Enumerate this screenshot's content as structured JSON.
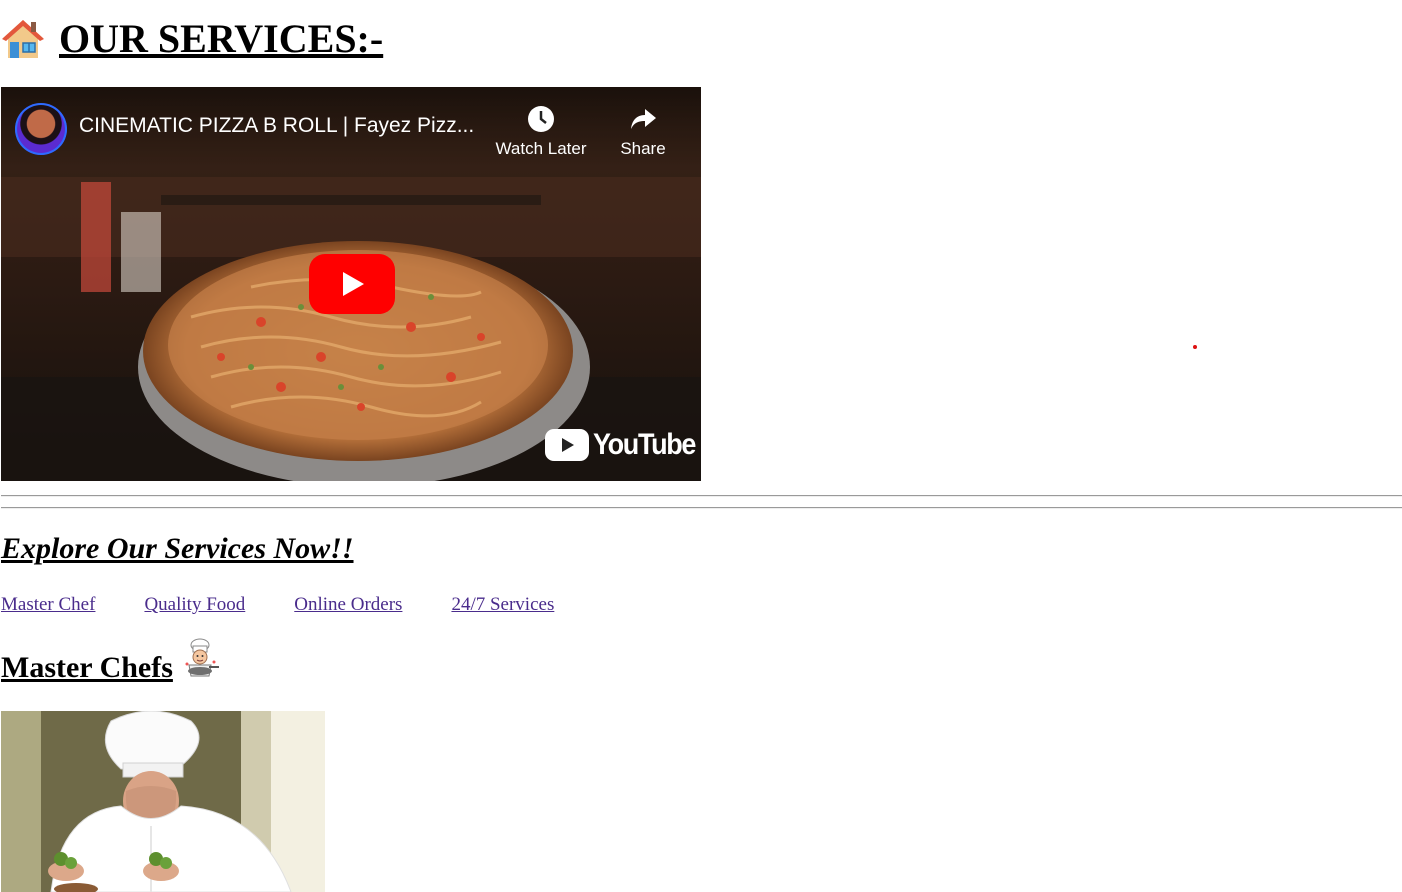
{
  "header": {
    "title": "OUR SERVICES:-",
    "icon": "house-icon"
  },
  "video": {
    "title": "CINEMATIC PIZZA B ROLL | Fayez Pizz...",
    "watch_later_label": "Watch Later",
    "share_label": "Share",
    "logo_text": "YouTube",
    "icons": [
      "channel-avatar",
      "clock-icon",
      "share-arrow-icon",
      "play-icon",
      "youtube-logo-icon"
    ]
  },
  "explore": {
    "title": "Explore Our Services Now!!"
  },
  "nav": {
    "links": [
      "Master Chef",
      "Quality Food",
      "Online Orders",
      "24/7 Services"
    ]
  },
  "chefs": {
    "title": "Master Chefs",
    "icon": "cook-icon"
  },
  "colors": {
    "link": "#4a2c8c",
    "youtube_red": "#ff0000",
    "dot": "#dd1111"
  }
}
